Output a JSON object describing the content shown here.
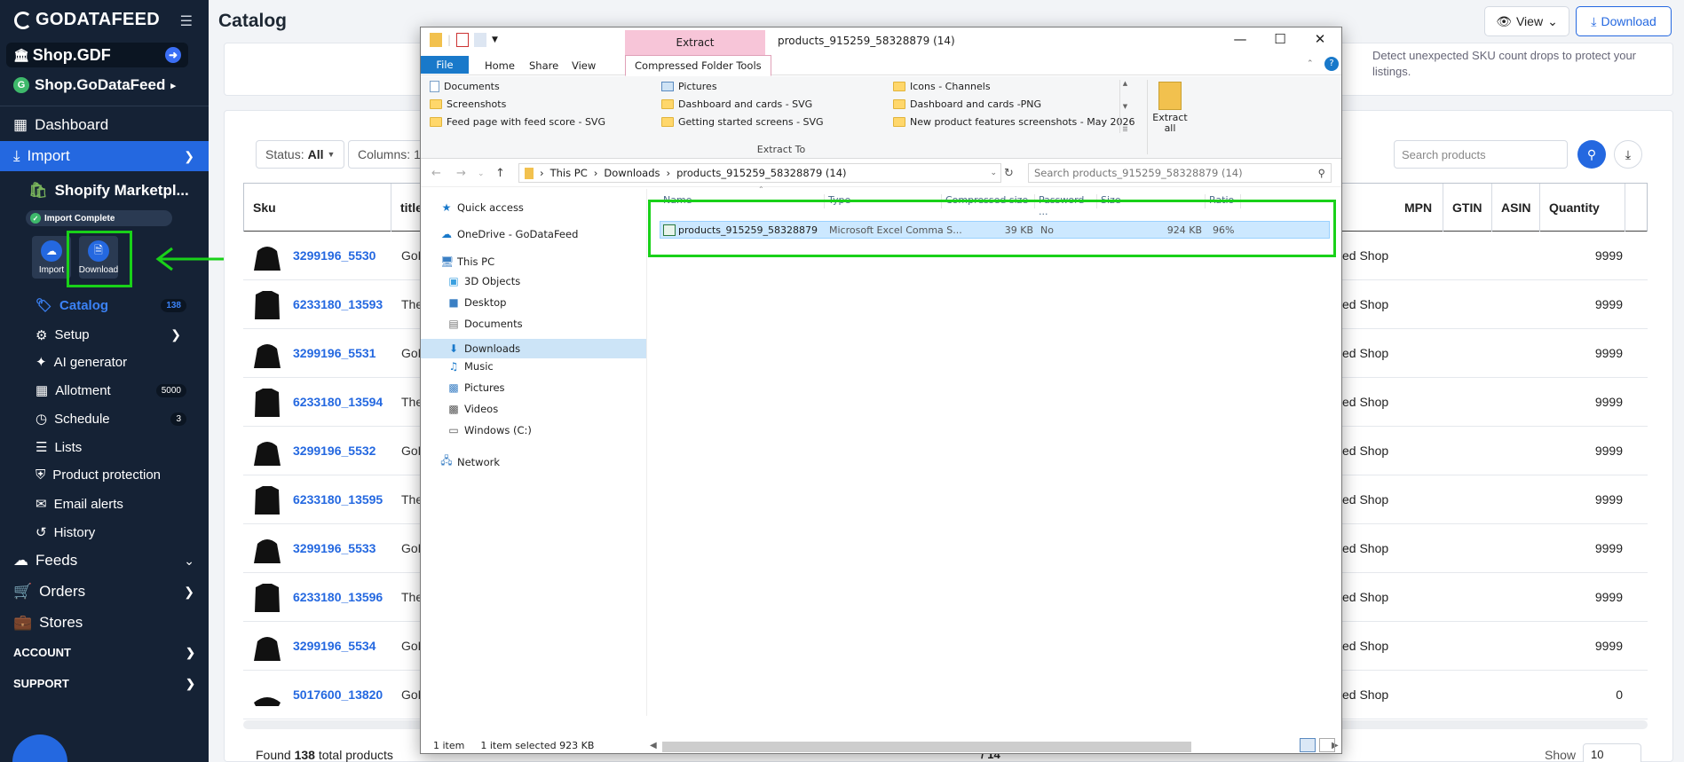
{
  "sidebar": {
    "logo": "GODATAFEED",
    "shop_primary": "Shop.GDF",
    "shop_secondary": "Shop.GoDataFeed",
    "shop_secondary_badge": "G",
    "nav_dashboard": "Dashboard",
    "nav_import": "Import",
    "import_source": "Shopify Marketpl...",
    "import_status": "Import Complete",
    "tool_import": "Import",
    "tool_download": "Download",
    "sub": [
      {
        "label": "Catalog",
        "badge": "138"
      },
      {
        "label": "Setup",
        "badge": ""
      },
      {
        "label": "AI generator",
        "badge": ""
      },
      {
        "label": "Allotment",
        "badge": "5000"
      },
      {
        "label": "Schedule",
        "badge": "3"
      },
      {
        "label": "Lists",
        "badge": ""
      },
      {
        "label": "Product protection",
        "badge": ""
      },
      {
        "label": "Email alerts",
        "badge": ""
      },
      {
        "label": "History",
        "badge": ""
      }
    ],
    "nav_feeds": "Feeds",
    "nav_orders": "Orders",
    "nav_stores": "Stores",
    "section_account": "ACCOUNT",
    "section_support": "SUPPORT"
  },
  "header": {
    "title": "Catalog",
    "view_label": "View",
    "download_label": "Download"
  },
  "notice": {
    "text": "Detect unexpected SKU count drops to protect your listings."
  },
  "toolbar": {
    "status_label": "Status:",
    "status_value": "All",
    "columns_label": "Columns:",
    "columns_value": "1",
    "search_placeholder": "Search products"
  },
  "table": {
    "headers": {
      "sku": "Sku",
      "title": "title",
      "mpn": "MPN",
      "gtin": "GTIN",
      "asin": "ASIN",
      "quantity": "Quantity"
    },
    "rows": [
      {
        "sku": "3299196_5530",
        "title": "GoD",
        "shop": "ed Shop",
        "qty": "9999",
        "kind": "hoodie"
      },
      {
        "sku": "6233180_13593",
        "title": "The",
        "shop": "ed Shop",
        "qty": "9999",
        "kind": "shirt"
      },
      {
        "sku": "3299196_5531",
        "title": "GoD",
        "shop": "ed Shop",
        "qty": "9999",
        "kind": "hoodie"
      },
      {
        "sku": "6233180_13594",
        "title": "The",
        "shop": "ed Shop",
        "qty": "9999",
        "kind": "shirt"
      },
      {
        "sku": "3299196_5532",
        "title": "GoD",
        "shop": "ed Shop",
        "qty": "9999",
        "kind": "hoodie"
      },
      {
        "sku": "6233180_13595",
        "title": "The",
        "shop": "ed Shop",
        "qty": "9999",
        "kind": "shirt"
      },
      {
        "sku": "3299196_5533",
        "title": "GoD",
        "shop": "ed Shop",
        "qty": "9999",
        "kind": "hoodie"
      },
      {
        "sku": "6233180_13596",
        "title": "The",
        "shop": "ed Shop",
        "qty": "9999",
        "kind": "shirt"
      },
      {
        "sku": "3299196_5534",
        "title": "GoD",
        "shop": "ed Shop",
        "qty": "9999",
        "kind": "hoodie"
      },
      {
        "sku": "5017600_13820",
        "title": "GoD",
        "shop": "ed Shop",
        "qty": "0",
        "kind": "hat"
      }
    ]
  },
  "footer": {
    "found_prefix": "Found",
    "found_count": "138",
    "found_suffix": "total products",
    "page_total": "14",
    "show_label": "Show",
    "show_value": "10"
  },
  "explorer": {
    "context_tab": "Extract",
    "window_title": "products_915259_58328879 (14)",
    "tabs": {
      "file": "File",
      "home": "Home",
      "share": "Share",
      "view": "View",
      "cft": "Compressed Folder Tools"
    },
    "ribbon_destinations": [
      {
        "label": "Documents",
        "icon": "doc"
      },
      {
        "label": "Screenshots",
        "icon": "folder"
      },
      {
        "label": "Feed page with feed score - SVG",
        "icon": "folder"
      },
      {
        "label": "Pictures",
        "icon": "pic"
      },
      {
        "label": "Dashboard and cards - SVG",
        "icon": "folder"
      },
      {
        "label": "Getting started screens - SVG",
        "icon": "folder"
      },
      {
        "label": "Icons - Channels",
        "icon": "folder"
      },
      {
        "label": "Dashboard and cards -PNG",
        "icon": "folder"
      },
      {
        "label": "New product features screenshots - May 2026",
        "icon": "folder"
      }
    ],
    "extract_all": "Extract all",
    "extract_to": "Extract To",
    "address": [
      "This PC",
      "Downloads",
      "products_915259_58328879 (14)"
    ],
    "search_placeholder": "Search products_915259_58328879 (14)",
    "nav": [
      {
        "label": "Quick access",
        "level": 0
      },
      {
        "label": "OneDrive - GoDataFeed",
        "level": 0
      },
      {
        "label": "This PC",
        "level": 0
      },
      {
        "label": "3D Objects",
        "level": 1
      },
      {
        "label": "Desktop",
        "level": 1
      },
      {
        "label": "Documents",
        "level": 1
      },
      {
        "label": "Downloads",
        "level": 1
      },
      {
        "label": "Music",
        "level": 1
      },
      {
        "label": "Pictures",
        "level": 1
      },
      {
        "label": "Videos",
        "level": 1
      },
      {
        "label": "Windows (C:)",
        "level": 1
      },
      {
        "label": "Network",
        "level": 0
      }
    ],
    "columns": [
      "Name",
      "Type",
      "Compressed size",
      "Password ...",
      "Size",
      "Ratio"
    ],
    "file": {
      "name": "products_915259_58328879",
      "type": "Microsoft Excel Comma S...",
      "compressed": "39 KB",
      "password": "No",
      "size": "924 KB",
      "ratio": "96%"
    },
    "status_items": "1 item",
    "status_selected": "1 item selected  923 KB"
  },
  "colors": {
    "sidebar_bg": "#152235",
    "accent": "#2468e0",
    "highlight_green": "#19d119"
  }
}
